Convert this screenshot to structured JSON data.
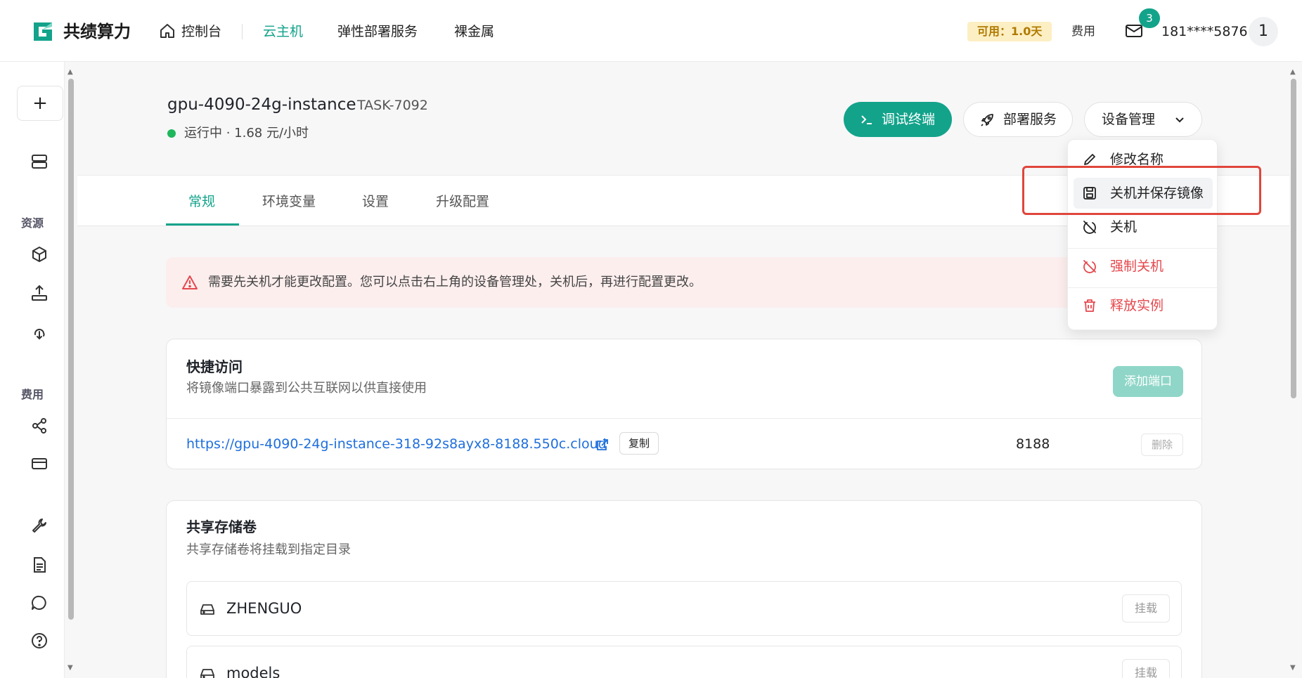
{
  "brand": {
    "name": "共绩算力",
    "color": "#13a38b"
  },
  "nav": {
    "console": "控制台",
    "cloud_host": "云主机",
    "elastic_service": "弹性部署服务",
    "bare_metal": "裸金属"
  },
  "header_right": {
    "balance": "可用：1.0天",
    "fee": "费用",
    "mail_badge": "3",
    "phone": "181****5876",
    "avatar": "1"
  },
  "sidebar": {
    "add_label": "+",
    "section_resources": "资源",
    "section_fees": "费用"
  },
  "instance": {
    "name": "gpu-4090-24g-instance",
    "task_id": "TASK-7092",
    "status": "运行中 · 1.68 元/小时"
  },
  "actions": {
    "terminal": "调试终端",
    "deploy": "部署服务",
    "device_manage": "设备管理"
  },
  "dropdown": {
    "items": [
      {
        "label": "修改名称",
        "icon": "pencil-icon"
      },
      {
        "label": "关机并保存镜像",
        "icon": "save-image-icon"
      },
      {
        "label": "关机",
        "icon": "power-off-icon"
      },
      {
        "label": "强制关机",
        "icon": "force-power-off-icon"
      },
      {
        "label": "释放实例",
        "icon": "trash-icon"
      }
    ]
  },
  "tabs": [
    "常规",
    "环境变量",
    "设置",
    "升级配置"
  ],
  "alert": {
    "text": "需要先关机才能更改配置。您可以点击右上角的设备管理处，关机后，再进行配置更改。"
  },
  "quick_access": {
    "title": "快捷访问",
    "subtitle": "将镜像端口暴露到公共互联网以供直接使用",
    "add_port": "添加端口",
    "url": "https://gpu-4090-24g-instance-318-92s8ayx8-8188.550c.cloud",
    "copy": "复制",
    "port": "8188",
    "delete": "删除"
  },
  "storage": {
    "title": "共享存储卷",
    "subtitle": "共享存储卷将挂载到指定目录",
    "volumes": [
      {
        "name": "ZHENGUO",
        "mount": "挂载"
      },
      {
        "name": "models",
        "mount": "挂载"
      }
    ]
  },
  "colors": {
    "accent": "#13a38b",
    "danger": "#e5484d",
    "highlight": "#e0463c",
    "link": "#1e6fdc"
  }
}
